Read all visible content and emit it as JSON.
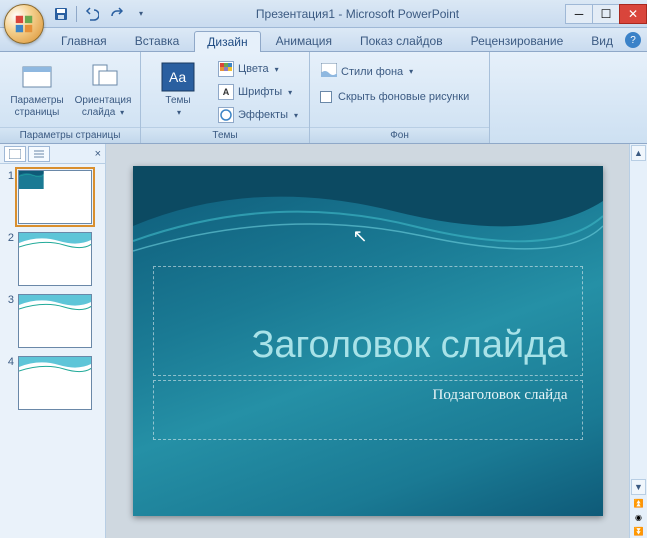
{
  "title": "Презентация1 - Microsoft PowerPoint",
  "tabs": {
    "home": "Главная",
    "insert": "Вставка",
    "design": "Дизайн",
    "animation": "Анимация",
    "slideshow": "Показ слайдов",
    "review": "Рецензирование",
    "view": "Вид"
  },
  "ribbon": {
    "page_setup_group": "Параметры страницы",
    "page_setup": "Параметры страницы",
    "orientation": "Ориентация слайда",
    "themes_group": "Темы",
    "themes": "Темы",
    "colors": "Цвета",
    "fonts": "Шрифты",
    "effects": "Эффекты",
    "background_group": "Фон",
    "bg_styles": "Стили фона",
    "hide_bg": "Скрыть фоновые рисунки"
  },
  "slide": {
    "title": "Заголовок слайда",
    "subtitle": "Подзаголовок слайда"
  },
  "thumbs": [
    "1",
    "2",
    "3",
    "4"
  ]
}
